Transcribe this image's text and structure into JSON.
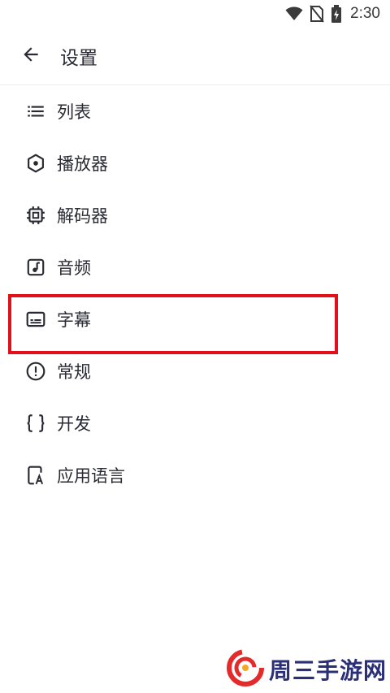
{
  "status_bar": {
    "time": "2:30",
    "icons": [
      "wifi-icon",
      "no-sim-icon",
      "battery-charging-icon"
    ]
  },
  "app_bar": {
    "back_icon": "arrow-left-icon",
    "title": "设置"
  },
  "settings": {
    "items": [
      {
        "key": "list",
        "icon": "list-icon",
        "label": "列表"
      },
      {
        "key": "player",
        "icon": "hexagon-dot-icon",
        "label": "播放器"
      },
      {
        "key": "decoder",
        "icon": "chip-icon",
        "label": "解码器"
      },
      {
        "key": "audio",
        "icon": "music-note-icon",
        "label": "音频"
      },
      {
        "key": "subtitle",
        "icon": "subtitles-icon",
        "label": "字幕",
        "highlighted": true
      },
      {
        "key": "general",
        "icon": "alert-circle-icon",
        "label": "常规"
      },
      {
        "key": "developer",
        "icon": "code-braces-icon",
        "label": "开发"
      },
      {
        "key": "app_language",
        "icon": "phone-language-icon",
        "label": "应用语言"
      }
    ]
  },
  "highlight": {
    "target": "subtitle",
    "color": "#e3101b"
  },
  "watermark": {
    "text": "周三手游网",
    "text_color": "#2b2f77",
    "logo_colors": [
      "#e32b2b",
      "#f5a623"
    ]
  },
  "colors": {
    "text": "#2a2a34",
    "divider": "#ececec",
    "background": "#ffffff"
  }
}
